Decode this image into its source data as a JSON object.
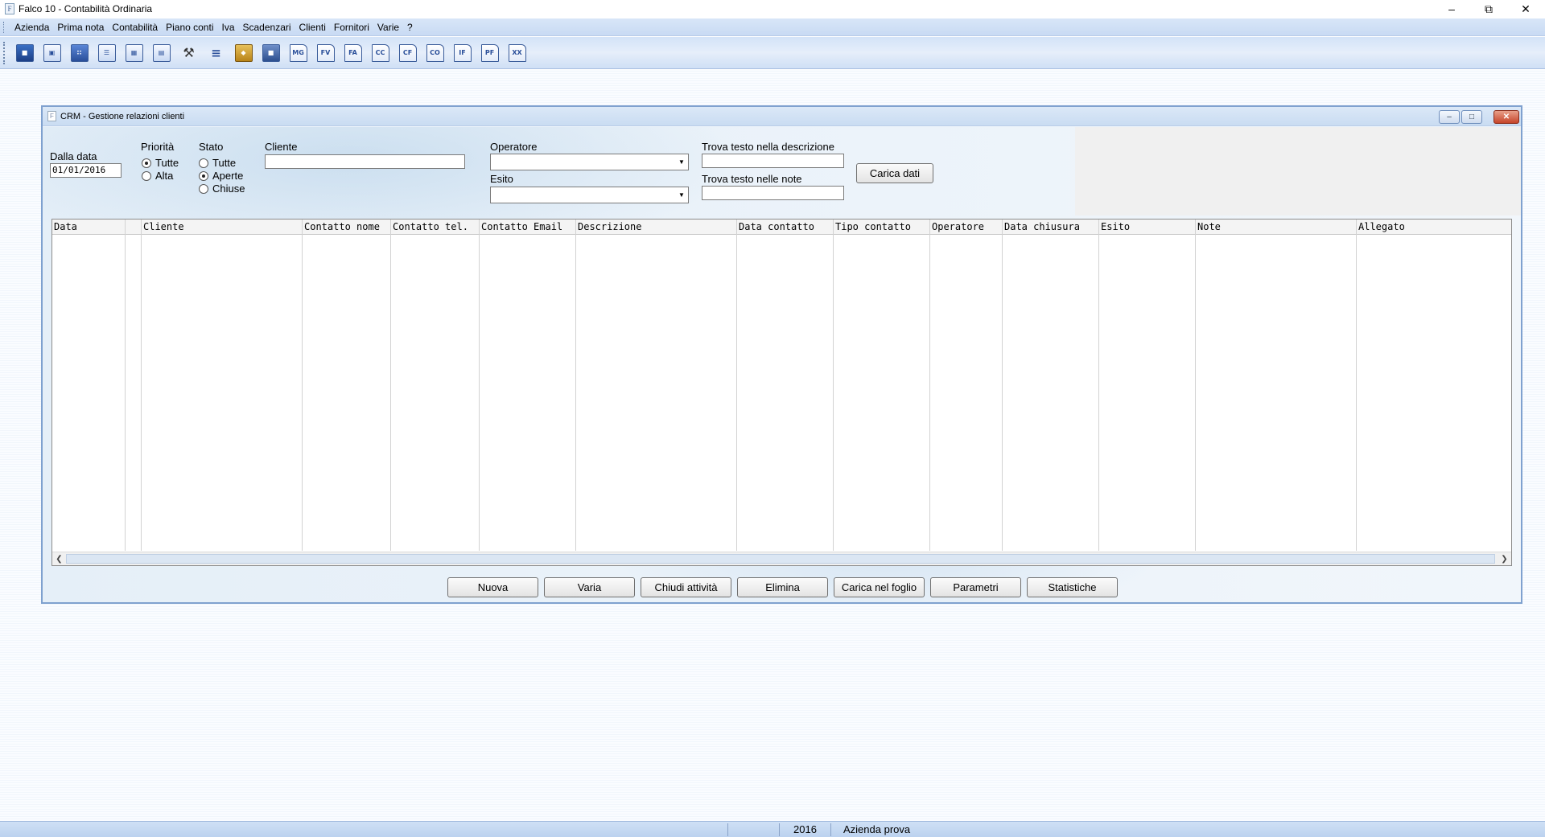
{
  "app": {
    "title": "Falco 10 - Contabilità Ordinaria",
    "icon_letter": "F"
  },
  "menu": [
    "Azienda",
    "Prima nota",
    "Contabilità",
    "Piano conti",
    "Iva",
    "Scadenzari",
    "Clienti",
    "Fornitori",
    "Varie",
    "?"
  ],
  "toolbar": {
    "icons": [
      "exit-door-icon",
      "windows-icon",
      "calculator-icon",
      "table-icon",
      "calendar-icon",
      "agenda-icon",
      "tools-icon",
      "tree-icon",
      "archive-icon",
      "print-icon"
    ],
    "doc_icons": [
      "MG",
      "FV",
      "FA",
      "CC",
      "CF",
      "CO",
      "IF",
      "PF",
      "XX"
    ]
  },
  "crm": {
    "title": "CRM - Gestione relazioni clienti",
    "filters": {
      "dalla_data_label": "Dalla data",
      "dalla_data_value": "01/01/2016",
      "priorita_label": "Priorità",
      "priorita_options": [
        "Tutte",
        "Alta"
      ],
      "stato_label": "Stato",
      "stato_options": [
        "Tutte",
        "Aperte",
        "Chiuse"
      ],
      "cliente_label": "Cliente",
      "cliente_value": "",
      "operatore_label": "Operatore",
      "esito_label": "Esito",
      "trova_descrizione_label": "Trova testo nella descrizione",
      "trova_note_label": "Trova testo nelle note",
      "carica_dati": "Carica dati"
    },
    "columns": [
      "Data",
      "",
      "Cliente",
      "Contatto nome",
      "Contatto tel.",
      "Contatto Email",
      "Descrizione",
      "Data contatto",
      "Tipo contatto",
      "Operatore",
      "Data chiusura",
      "Esito",
      "Note",
      "Allegato"
    ],
    "buttons": [
      "Nuova",
      "Varia",
      "Chiudi attività",
      "Elimina",
      "Carica nel foglio",
      "Parametri",
      "Statistiche"
    ]
  },
  "status": {
    "year": "2016",
    "company": "Azienda prova"
  }
}
